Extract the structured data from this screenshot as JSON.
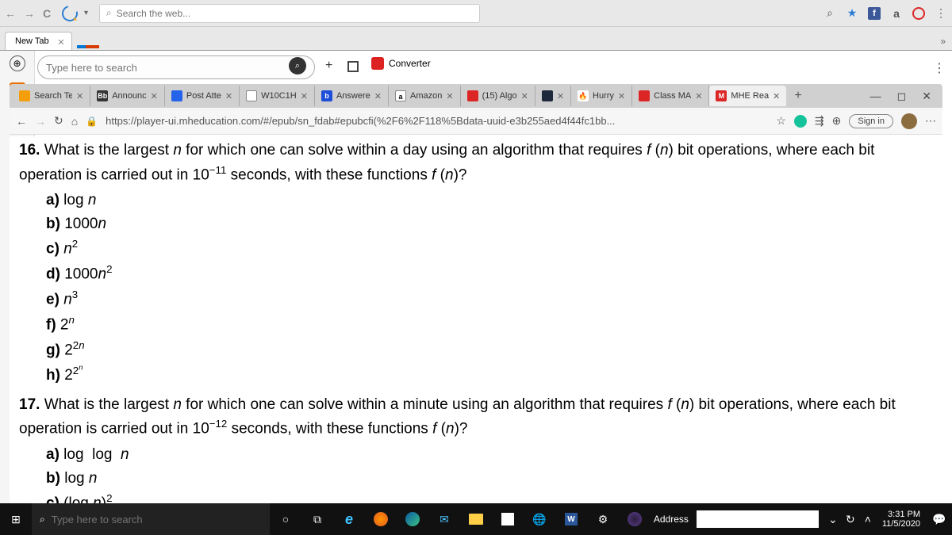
{
  "outer": {
    "search_placeholder": "Search the web...",
    "tab_label": "New Tab"
  },
  "pill": {
    "placeholder": "Type here to search"
  },
  "converter_label": "Converter",
  "edge_tabs": [
    {
      "fav": "#f59e0b",
      "label": "Search Te"
    },
    {
      "fav": "#333",
      "label": "Announc",
      "txtcolor": "#fff",
      "txt": "Bb"
    },
    {
      "fav": "#2563eb",
      "label": "Post Atte"
    },
    {
      "fav": "#fff",
      "label": "W10C1H",
      "border": "1px solid #888"
    },
    {
      "fav": "#1d4ed8",
      "label": "Answere",
      "txt": "b",
      "txtcolor": "#fff"
    },
    {
      "fav": "#fff",
      "label": "Amazon",
      "txt": "a",
      "border": "1px solid #888"
    },
    {
      "fav": "#dc2626",
      "label": "(15) Algo"
    },
    {
      "fav": "#1e293b",
      "label": ""
    },
    {
      "fav": "#fff",
      "label": "Hurry",
      "txt": "🔥"
    },
    {
      "fav": "#dc2626",
      "label": "Class MA"
    },
    {
      "fav": "#dc2626",
      "label": "MHE Rea",
      "txt": "M",
      "txtcolor": "#fff",
      "active": true
    }
  ],
  "edge_url": "https://player-ui.mheducation.com/#/epub/sn_fdab#epubcfi(%2F6%2F118%5Bdata-uuid-e3b255aed4f44fc1bb...",
  "signin": "Sign in",
  "questions": {
    "q16": {
      "num": "16.",
      "text_a": "What is the largest ",
      "text_b": " for which one can solve within a day using an algorithm that requires ",
      "text_c": " bit operations, where each bit operation is carried out in 10",
      "text_d": " seconds, with these functions ",
      "exp": "−11",
      "opts": [
        "log n",
        "1000n",
        "n",
        "1000n",
        "n",
        "2",
        "2",
        "2"
      ]
    },
    "q17": {
      "num": "17.",
      "text_a": "What is the largest ",
      "text_b": " for which one can solve within a minute using an algorithm that requires ",
      "text_c": " bit operations, where each bit operation is carried out in 10",
      "text_d": " seconds, with these functions ",
      "exp": "−12"
    }
  },
  "taskbar": {
    "search_placeholder": "Type here to search",
    "address_label": "Address",
    "time": "3:31 PM",
    "date": "11/5/2020"
  }
}
